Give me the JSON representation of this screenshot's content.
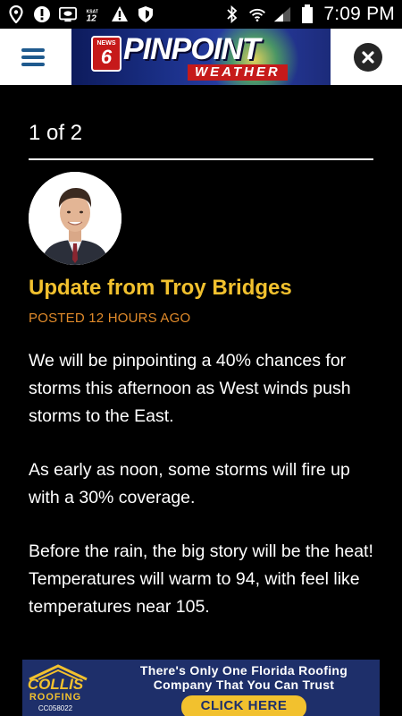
{
  "status_bar": {
    "time": "7:09 PM",
    "left_icons": [
      "location-icon",
      "alert-icon",
      "tv-icon",
      "ksat-12-icon",
      "warning-icon",
      "shield-icon"
    ],
    "right_icons": [
      "bluetooth-icon",
      "wifi-icon",
      "signal-icon",
      "battery-icon"
    ]
  },
  "header": {
    "logo": {
      "badge_network": "NEWS",
      "badge_channel": "6",
      "brand": "PINPOINT",
      "subbrand": "WEATHER"
    }
  },
  "update": {
    "counter": "1 of 2",
    "title": "Update from Troy Bridges",
    "posted": "POSTED 12 HOURS AGO",
    "paragraphs": [
      "We will be pinpointing a 40% chances for storms this afternoon as West winds push storms to the East.",
      "As early as noon, some storms will fire up with a 30% coverage.",
      "Before the rain, the big story will be the heat! Temperatures will warm to 94, with feel like temperatures near 105."
    ]
  },
  "ad": {
    "brand": "COLLIS",
    "brand_sub": "ROOFING",
    "license": "CC058022",
    "headline_1": "There's Only One Florida Roofing",
    "headline_2": "Company That You Can Trust",
    "cta": "CLICK HERE"
  },
  "colors": {
    "title": "#f2c12e",
    "posted": "#e08a2a",
    "menu": "#1f5a8e",
    "ad_background": "#1e2f6a"
  }
}
